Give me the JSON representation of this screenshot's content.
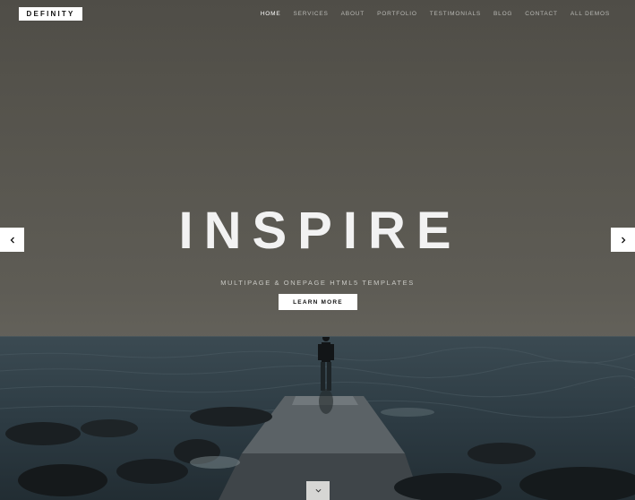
{
  "header": {
    "logo": "DEFINITY",
    "nav": [
      {
        "label": "HOME",
        "active": true
      },
      {
        "label": "SERVICES",
        "active": false
      },
      {
        "label": "ABOUT",
        "active": false
      },
      {
        "label": "PORTFOLIO",
        "active": false
      },
      {
        "label": "TESTIMONIALS",
        "active": false
      },
      {
        "label": "BLOG",
        "active": false
      },
      {
        "label": "CONTACT",
        "active": false
      },
      {
        "label": "ALL DEMOS",
        "active": false
      }
    ]
  },
  "hero": {
    "title": "INSPIRE",
    "subtitle": "MULTIPAGE & ONEPAGE HTML5 TEMPLATES",
    "cta_label": "LEARN MORE"
  },
  "slider": {
    "prev_icon": "chevron-left-icon",
    "next_icon": "chevron-right-icon",
    "scroll_icon": "chevron-down-icon"
  },
  "colors": {
    "accent": "#ffffff",
    "nav_text": "#b9b9b5",
    "sky": "#55534c",
    "sea": "#2c3a42"
  }
}
